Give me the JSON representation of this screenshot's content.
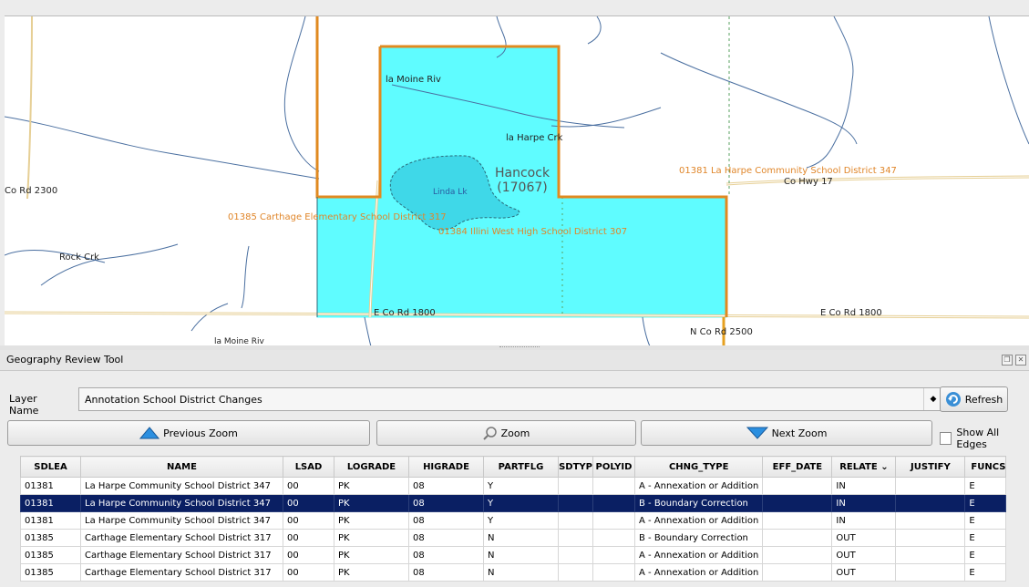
{
  "map": {
    "place_name": "Hancock",
    "place_code": "(17067)",
    "water_label": "Linda Lk",
    "labels": {
      "la_moine_riv_top": "la Moine Riv",
      "la_harpe_crk": "la Harpe Crk",
      "co_rd_2300": "Co Rd 2300",
      "carthage_district": "01385 Carthage Elementary School District 317",
      "illini_district": "01384 Illini West High School District 307",
      "la_harpe_district": "01381 La Harpe Community School District 347",
      "co_hwy_17": "Co Hwy 17",
      "rock_crk": "Rock Crk",
      "e_co_rd_1800_left": "E Co Rd 1800",
      "e_co_rd_1800_right": "E Co Rd 1800",
      "n_co_rd_2500": "N Co Rd 2500",
      "la_moine_riv_bottom": "la Moine Riv"
    }
  },
  "panel": {
    "title": "Geography Review Tool",
    "float_icon": "restore-icon",
    "close_icon": "close-icon"
  },
  "layer": {
    "label": "Layer Name :",
    "value": "Annotation School District Changes",
    "refresh": "Refresh"
  },
  "toolbar": {
    "previous_zoom": "Previous Zoom",
    "zoom": "Zoom",
    "next_zoom": "Next Zoom",
    "show_all_edges": "Show All Edges"
  },
  "table": {
    "headers": [
      "SDLEA",
      "NAME",
      "LSAD",
      "LOGRADE",
      "HIGRADE",
      "PARTFLG",
      "SDTYP",
      "POLYID",
      "CHNG_TYPE",
      "EFF_DATE",
      "RELATE",
      "JUSTIFY",
      "FUNCS"
    ],
    "rows": [
      [
        "01381",
        "La Harpe Community School District 347",
        "00",
        "PK",
        "08",
        "Y",
        "",
        "",
        "A - Annexation or Addition",
        "",
        "IN",
        "",
        "E"
      ],
      [
        "01381",
        "La Harpe Community School District 347",
        "00",
        "PK",
        "08",
        "Y",
        "",
        "",
        "B - Boundary Correction",
        "",
        "IN",
        "",
        "E"
      ],
      [
        "01381",
        "La Harpe Community School District 347",
        "00",
        "PK",
        "08",
        "Y",
        "",
        "",
        "A - Annexation or Addition",
        "",
        "IN",
        "",
        "E"
      ],
      [
        "01385",
        "Carthage Elementary School District 317",
        "00",
        "PK",
        "08",
        "N",
        "",
        "",
        "B - Boundary Correction",
        "",
        "OUT",
        "",
        "E"
      ],
      [
        "01385",
        "Carthage Elementary School District 317",
        "00",
        "PK",
        "08",
        "N",
        "",
        "",
        "A - Annexation or Addition",
        "",
        "OUT",
        "",
        "E"
      ],
      [
        "01385",
        "Carthage Elementary School District 317",
        "00",
        "PK",
        "08",
        "N",
        "",
        "",
        "A - Annexation or Addition",
        "",
        "OUT",
        "",
        "E"
      ]
    ],
    "selected_row": 1
  },
  "colors": {
    "district_fill": "#5ffcff",
    "boundary": "#e08a20",
    "selection": "#0a1f63"
  }
}
